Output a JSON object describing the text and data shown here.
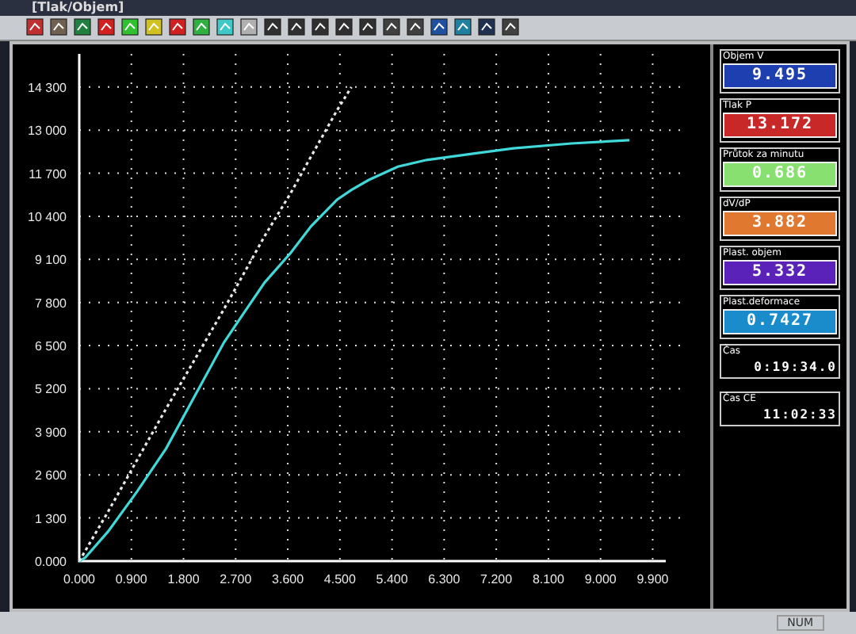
{
  "window": {
    "title": "[Tlak/Objem]"
  },
  "chart": {
    "chart_data": {
      "type": "line",
      "grid": true,
      "xlim": [
        0,
        10.4
      ],
      "ylim": [
        0,
        15300
      ],
      "x": [
        0,
        0.1,
        0.5,
        1.0,
        1.5,
        2.0,
        2.5,
        2.85,
        3.2,
        3.65,
        4.0,
        4.45,
        4.7,
        5.0,
        5.5,
        6.0,
        6.85,
        7.5,
        8.5,
        9.5
      ],
      "series": [
        {
          "color": "#40d8d8",
          "line_style": "solid",
          "values": [
            0,
            100,
            900,
            2100,
            3400,
            5000,
            6600,
            7500,
            8400,
            9300,
            10100,
            10900,
            11200,
            11500,
            11900,
            12100,
            12300,
            12450,
            12600,
            12700
          ]
        },
        {
          "color": "#e8e8e8",
          "line_style": "dotted",
          "values": [
            0,
            300,
            1500,
            3050,
            4600,
            6100,
            7600,
            8700,
            9800,
            11100,
            12200,
            13600,
            14300,
            null,
            null,
            null,
            null,
            null,
            null,
            null
          ]
        }
      ],
      "xticks": [
        {
          "value": 0,
          "label": "0.000"
        },
        {
          "value": 0.9,
          "label": "0.900"
        },
        {
          "value": 1.8,
          "label": "1.800"
        },
        {
          "value": 2.7,
          "label": "2.700"
        },
        {
          "value": 3.6,
          "label": "3.600"
        },
        {
          "value": 4.5,
          "label": "4.500"
        },
        {
          "value": 5.4,
          "label": "5.400"
        },
        {
          "value": 6.3,
          "label": "6.300"
        },
        {
          "value": 7.2,
          "label": "7.200"
        },
        {
          "value": 8.1,
          "label": "8.100"
        },
        {
          "value": 9.0,
          "label": "9.000"
        },
        {
          "value": 9.9,
          "label": "9.900"
        }
      ],
      "yticks": [
        {
          "value": 0,
          "label": "0.000"
        },
        {
          "value": 1300,
          "label": "1 300"
        },
        {
          "value": 2600,
          "label": "2 600"
        },
        {
          "value": 3900,
          "label": "3 900"
        },
        {
          "value": 5200,
          "label": "5 200"
        },
        {
          "value": 6500,
          "label": "6 500"
        },
        {
          "value": 7800,
          "label": "7 800"
        },
        {
          "value": 9100,
          "label": "9 100"
        },
        {
          "value": 10400,
          "label": "10 400"
        },
        {
          "value": 11700,
          "label": "11 700"
        },
        {
          "value": 13000,
          "label": "13 000"
        },
        {
          "value": 14300,
          "label": "14 300"
        }
      ]
    }
  },
  "readouts": [
    {
      "kind": "value",
      "label": "Objem V",
      "value": "9.495",
      "color": "#1e3fb0"
    },
    {
      "kind": "value",
      "label": "Tlak P",
      "value": "13.172",
      "color": "#c82828"
    },
    {
      "kind": "value",
      "label": "Průtok za minutu",
      "value": "0.686",
      "color": "#88e070"
    },
    {
      "kind": "value",
      "label": "dV/dP",
      "value": "3.882",
      "color": "#e07830"
    },
    {
      "kind": "value",
      "label": "Plast. objem",
      "value": "5.332",
      "color": "#5a22b8"
    },
    {
      "kind": "value",
      "label": "Plast.deformace",
      "value": "0.7427",
      "color": "#1a8ccc"
    },
    {
      "kind": "time",
      "label": "Čas",
      "value": "0:19:34.0"
    },
    {
      "kind": "time",
      "label": "Čas CE",
      "value": "11:02:33"
    }
  ],
  "status_bar": {
    "indicator": "NUM"
  }
}
